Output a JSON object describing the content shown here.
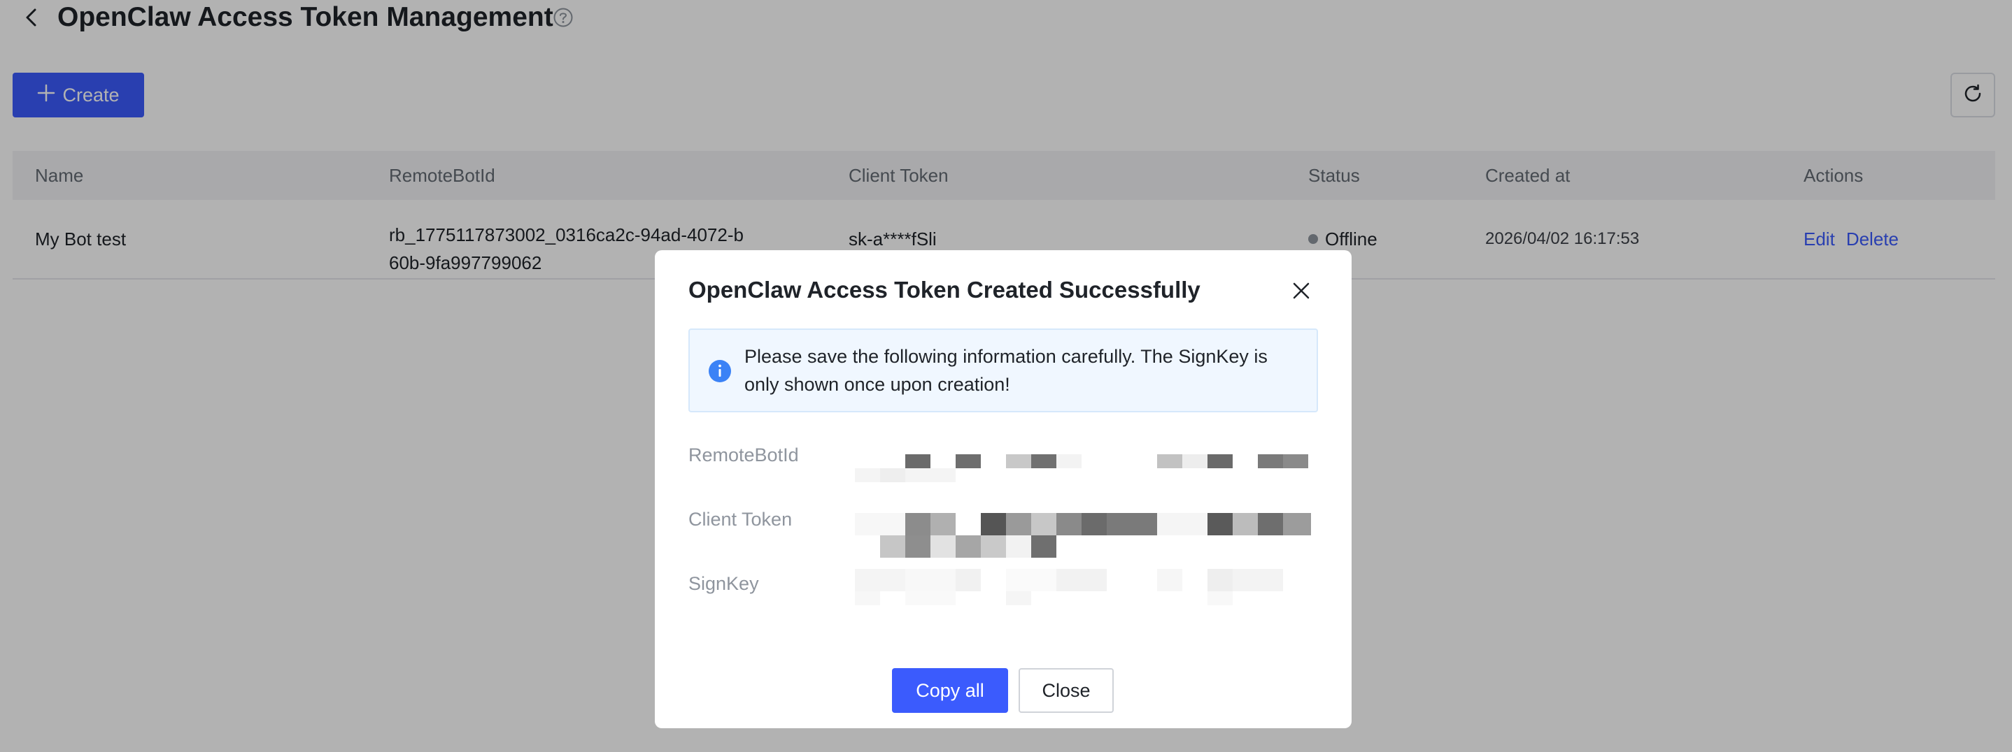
{
  "header": {
    "title": "OpenClaw Access Token Management"
  },
  "toolbar": {
    "create_label": "Create"
  },
  "table": {
    "columns": [
      "Name",
      "RemoteBotId",
      "Client Token",
      "Status",
      "Created at",
      "Actions"
    ],
    "rows": [
      {
        "name": "My Bot test",
        "remote_bot_id_line1": "rb_1775117873002_0316ca2c-94ad-4072-b",
        "remote_bot_id_line2": "60b-9fa997799062",
        "client_token": "sk-a****fSli",
        "status": "Offline",
        "created_at": "2026/04/02 16:17:53",
        "edit_label": "Edit",
        "delete_label": "Delete"
      }
    ]
  },
  "modal": {
    "title": "OpenClaw Access Token Created Successfully",
    "notice": "Please save the following information carefully. The SignKey is only shown once upon creation!",
    "fields": [
      {
        "label": "RemoteBotId"
      },
      {
        "label": "Client Token"
      },
      {
        "label": "SignKey"
      }
    ],
    "copy_all_label": "Copy all",
    "close_label": "Close"
  },
  "colors": {
    "primary": "#3b5bfd",
    "overlay": "rgba(0,0,0,0.30)",
    "status_offline": "#8f959e"
  },
  "icons": [
    "back-arrow-icon",
    "help-circle-icon",
    "plus-icon",
    "refresh-icon",
    "close-icon",
    "info-icon"
  ]
}
